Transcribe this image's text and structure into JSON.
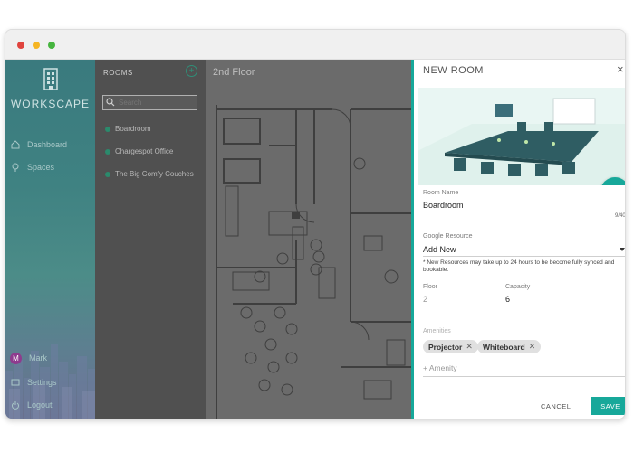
{
  "window": {
    "dots": [
      "#e0443e",
      "#f5b523",
      "#46b53f"
    ]
  },
  "sidebar": {
    "logo_text": "WORKSCAPE",
    "items": [
      {
        "label": "Dashboard",
        "icon": "home-icon"
      },
      {
        "label": "Spaces",
        "icon": "location-pin-icon"
      }
    ],
    "user": {
      "initial": "M",
      "name": "Mark"
    },
    "settings_label": "Settings",
    "logout_label": "Logout"
  },
  "rooms": {
    "title": "ROOMS",
    "search_placeholder": "Search",
    "items": [
      "Boardroom",
      "Chargespot Office",
      "The Big Comfy Couches"
    ]
  },
  "floor": {
    "title": "2nd Floor"
  },
  "modal": {
    "title": "NEW ROOM",
    "room_name_label": "Room Name",
    "room_name_value": "Boardroom",
    "char_count": "9/40",
    "google_resource_label": "Google Resource",
    "google_resource_value": "Add New",
    "note": "* New Resources may take up to 24 hours to be become fully synced and bookable.",
    "floor_label": "Floor",
    "floor_value": "2",
    "capacity_label": "Capacity",
    "capacity_value": "6",
    "amenities_label": "Amenities",
    "amenities": [
      "Projector",
      "Whiteboard"
    ],
    "add_amenity_label": "+ Amenity",
    "cancel_label": "CANCEL",
    "save_label": "SAVE",
    "accent_color": "#17a89a"
  }
}
